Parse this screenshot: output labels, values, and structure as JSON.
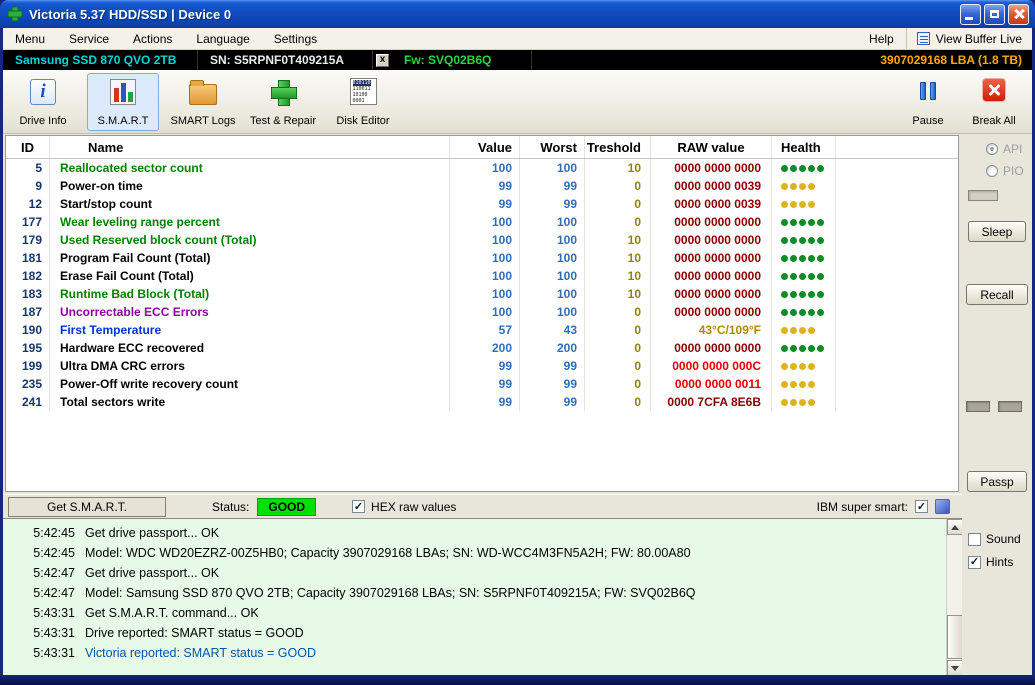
{
  "colors": {
    "green": "#008000",
    "black": "#000000",
    "purple": "#8c00a0",
    "blue": "#0032d8",
    "maroon": "#8b0000",
    "red": "#e80000",
    "gold": "#b08800",
    "id_navy": "#16356b",
    "value_blue": "#2f6db8",
    "treshold_olive": "#8f8500",
    "dot_green": "#0e8c28",
    "dot_yellow": "#ddb41e",
    "log_blue": "#0055aa",
    "status_good_bg": "#00e000"
  },
  "icons": {
    "app": "victoria-green-cross-icon",
    "titlebar": [
      "minimize-icon",
      "maximize-icon",
      "close-icon"
    ],
    "view_buffer": "buffer-list-icon",
    "drive_info": "info-panel-icon",
    "smart": "bar-chart-icon",
    "smart_logs": "folder-icon",
    "test_repair": "green-plus-icon",
    "disk_editor": "binary-grid-icon",
    "pause": "pause-bars-icon",
    "break_all": "red-x-icon"
  },
  "window": {
    "title": "Victoria 5.37 HDD/SSD | Device 0"
  },
  "menu": {
    "items": [
      "Menu",
      "Service",
      "Actions",
      "Language",
      "Settings",
      "Help"
    ],
    "view_buffer_live": "View Buffer Live"
  },
  "device_bar": {
    "model": "Samsung SSD 870 QVO 2TB",
    "serial": "SN: S5RPNF0T409215A",
    "close": "x",
    "firmware": "Fw: SVQ02B6Q",
    "capacity": "3907029168 LBA (1.8 TB)"
  },
  "toolbar": {
    "drive_info": "Drive Info",
    "smart": "S.M.A.R.T",
    "smart_logs": "SMART Logs",
    "test_repair": "Test & Repair",
    "disk_editor": "Disk Editor",
    "pause": "Pause",
    "break_all": "Break All",
    "editor_icon_lines": [
      "010110",
      "110011",
      "10100",
      "0001"
    ]
  },
  "smart_table": {
    "columns": {
      "id": "ID",
      "name": "Name",
      "value": "Value",
      "worst": "Worst",
      "treshold": "Treshold",
      "raw": "RAW value",
      "health": "Health"
    },
    "rows": [
      {
        "id": "5",
        "name": "Reallocated sector count",
        "name_color": "green",
        "value": "100",
        "worst": "100",
        "treshold": "10",
        "raw": "0000 0000 0000",
        "raw_color": "maroon",
        "dots": 5,
        "dot_color": "dot_green"
      },
      {
        "id": "9",
        "name": "Power-on time",
        "name_color": "black",
        "value": "99",
        "worst": "99",
        "treshold": "0",
        "raw": "0000 0000 0039",
        "raw_color": "maroon",
        "dots": 4,
        "dot_color": "dot_yellow"
      },
      {
        "id": "12",
        "name": "Start/stop count",
        "name_color": "black",
        "value": "99",
        "worst": "99",
        "treshold": "0",
        "raw": "0000 0000 0039",
        "raw_color": "maroon",
        "dots": 4,
        "dot_color": "dot_yellow"
      },
      {
        "id": "177",
        "name": "Wear leveling range percent",
        "name_color": "green",
        "value": "100",
        "worst": "100",
        "treshold": "0",
        "raw": "0000 0000 0000",
        "raw_color": "maroon",
        "dots": 5,
        "dot_color": "dot_green"
      },
      {
        "id": "179",
        "name": "Used Reserved block count (Total)",
        "name_color": "green",
        "value": "100",
        "worst": "100",
        "treshold": "10",
        "raw": "0000 0000 0000",
        "raw_color": "maroon",
        "dots": 5,
        "dot_color": "dot_green"
      },
      {
        "id": "181",
        "name": "Program Fail Count (Total)",
        "name_color": "black",
        "value": "100",
        "worst": "100",
        "treshold": "10",
        "raw": "0000 0000 0000",
        "raw_color": "maroon",
        "dots": 5,
        "dot_color": "dot_green"
      },
      {
        "id": "182",
        "name": "Erase Fail Count (Total)",
        "name_color": "black",
        "value": "100",
        "worst": "100",
        "treshold": "10",
        "raw": "0000 0000 0000",
        "raw_color": "maroon",
        "dots": 5,
        "dot_color": "dot_green"
      },
      {
        "id": "183",
        "name": "Runtime Bad Block (Total)",
        "name_color": "green",
        "value": "100",
        "worst": "100",
        "treshold": "10",
        "raw": "0000 0000 0000",
        "raw_color": "maroon",
        "dots": 5,
        "dot_color": "dot_green"
      },
      {
        "id": "187",
        "name": "Uncorrectable ECC Errors",
        "name_color": "purple",
        "value": "100",
        "worst": "100",
        "treshold": "0",
        "raw": "0000 0000 0000",
        "raw_color": "maroon",
        "dots": 5,
        "dot_color": "dot_green"
      },
      {
        "id": "190",
        "name": "First Temperature",
        "name_color": "blue",
        "value": "57",
        "worst": "43",
        "treshold": "0",
        "raw": "43°C/109°F",
        "raw_color": "gold",
        "dots": 4,
        "dot_color": "dot_yellow"
      },
      {
        "id": "195",
        "name": "Hardware ECC recovered",
        "name_color": "black",
        "value": "200",
        "worst": "200",
        "treshold": "0",
        "raw": "0000 0000 0000",
        "raw_color": "maroon",
        "dots": 5,
        "dot_color": "dot_green"
      },
      {
        "id": "199",
        "name": "Ultra DMA CRC errors",
        "name_color": "black",
        "value": "99",
        "worst": "99",
        "treshold": "0",
        "raw": "0000 0000 000C",
        "raw_color": "red",
        "dots": 4,
        "dot_color": "dot_yellow"
      },
      {
        "id": "235",
        "name": "Power-Off write recovery count",
        "name_color": "black",
        "value": "99",
        "worst": "99",
        "treshold": "0",
        "raw": "0000 0000 0011",
        "raw_color": "red",
        "dots": 4,
        "dot_color": "dot_yellow"
      },
      {
        "id": "241",
        "name": "Total sectors write",
        "name_color": "black",
        "value": "99",
        "worst": "99",
        "treshold": "0",
        "raw": "0000 7CFA 8E6B",
        "raw_color": "maroon",
        "dots": 4,
        "dot_color": "dot_yellow"
      }
    ]
  },
  "sidebar": {
    "api_label": "API",
    "api_selected": true,
    "pio_label": "PIO",
    "pio_selected": false,
    "sleep_button": "Sleep",
    "recall_button": "Recall",
    "passp_button": "Passp",
    "sound_label": "Sound",
    "sound_checked": false,
    "hints_label": "Hints",
    "hints_checked": true
  },
  "status_bar": {
    "get_smart_button": "Get S.M.A.R.T.",
    "status_label": "Status:",
    "status_value": "GOOD",
    "hex_checkbox_label": "HEX raw values",
    "hex_checked": true,
    "ibm_label": "IBM super smart:",
    "ibm_checked": true
  },
  "log": {
    "lines": [
      {
        "time": "5:42:45",
        "text": "Get drive passport... OK"
      },
      {
        "time": "5:42:45",
        "text": "Model: WDC WD20EZRZ-00Z5HB0; Capacity 3907029168 LBAs; SN: WD-WCC4M3FN5A2H; FW: 80.00A80"
      },
      {
        "time": "5:42:47",
        "text": "Get drive passport... OK"
      },
      {
        "time": "5:42:47",
        "text": "Model: Samsung SSD 870 QVO 2TB; Capacity 3907029168 LBAs; SN: S5RPNF0T409215A; FW: SVQ02B6Q"
      },
      {
        "time": "5:43:31",
        "text": "Get S.M.A.R.T. command... OK"
      },
      {
        "time": "5:43:31",
        "text": "Drive reported: SMART status = GOOD"
      },
      {
        "time": "5:43:31",
        "text": "Victoria reported: SMART status = GOOD",
        "color": "log_blue"
      }
    ]
  }
}
